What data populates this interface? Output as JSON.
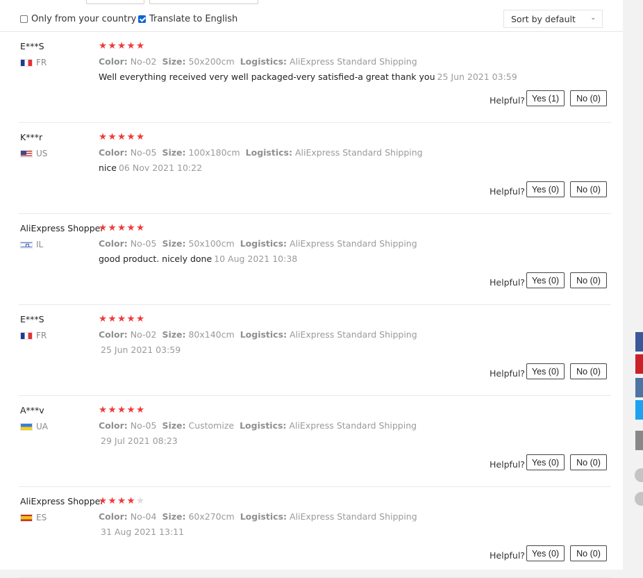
{
  "filters": {
    "only_country": "Only from your country",
    "translate": "Translate to English"
  },
  "sort": {
    "label": "Sort by default",
    "chevron": "⌄"
  },
  "labels": {
    "color": "Color:",
    "size": "Size:",
    "logistics": "Logistics:",
    "helpful": "Helpful?"
  },
  "reviews": [
    {
      "user": "E***S",
      "country": "FR",
      "flag": "flag-fr",
      "rating": 5,
      "color": "No-02",
      "size": "50x200cm",
      "logistics": "AliExpress Standard Shipping",
      "text": "Well everything received very well packaged-very satisfied-a great thank you",
      "date": "25 Jun 2021 03:59",
      "yes": "Yes (1)",
      "no": "No (0)"
    },
    {
      "user": "K***r",
      "country": "US",
      "flag": "flag-us",
      "rating": 5,
      "color": "No-05",
      "size": "100x180cm",
      "logistics": "AliExpress Standard Shipping",
      "text": "nice",
      "date": "06 Nov 2021 10:22",
      "yes": "Yes (0)",
      "no": "No (0)"
    },
    {
      "user": "AliExpress Shopper",
      "country": "IL",
      "flag": "flag-il",
      "rating": 5,
      "color": "No-05",
      "size": "50x100cm",
      "logistics": "AliExpress Standard Shipping",
      "text": "good product. nicely done",
      "date": "10 Aug 2021 10:38",
      "yes": "Yes (0)",
      "no": "No (0)"
    },
    {
      "user": "E***S",
      "country": "FR",
      "flag": "flag-fr",
      "rating": 5,
      "color": "No-02",
      "size": "80x140cm",
      "logistics": "AliExpress Standard Shipping",
      "text": "",
      "date": "25 Jun 2021 03:59",
      "yes": "Yes (0)",
      "no": "No (0)"
    },
    {
      "user": "A***v",
      "country": "UA",
      "flag": "flag-ua",
      "rating": 5,
      "color": "No-05",
      "size": "Customize",
      "logistics": "AliExpress Standard Shipping",
      "text": "",
      "date": "29 Jul 2021 08:23",
      "yes": "Yes (0)",
      "no": "No (0)"
    },
    {
      "user": "AliExpress Shopper",
      "country": "ES",
      "flag": "flag-es",
      "rating": 4,
      "color": "No-04",
      "size": "60x270cm",
      "logistics": "AliExpress Standard Shipping",
      "text": "",
      "date": "31 Aug 2021 13:11",
      "yes": "Yes (0)",
      "no": "No (0)"
    }
  ],
  "share_icons": [
    "facebook-icon",
    "pinterest-icon",
    "vk-icon",
    "twitter-icon",
    "more-icon"
  ],
  "colors": {
    "star": "#ef3b3b",
    "checkbox": "#0a66d6"
  }
}
